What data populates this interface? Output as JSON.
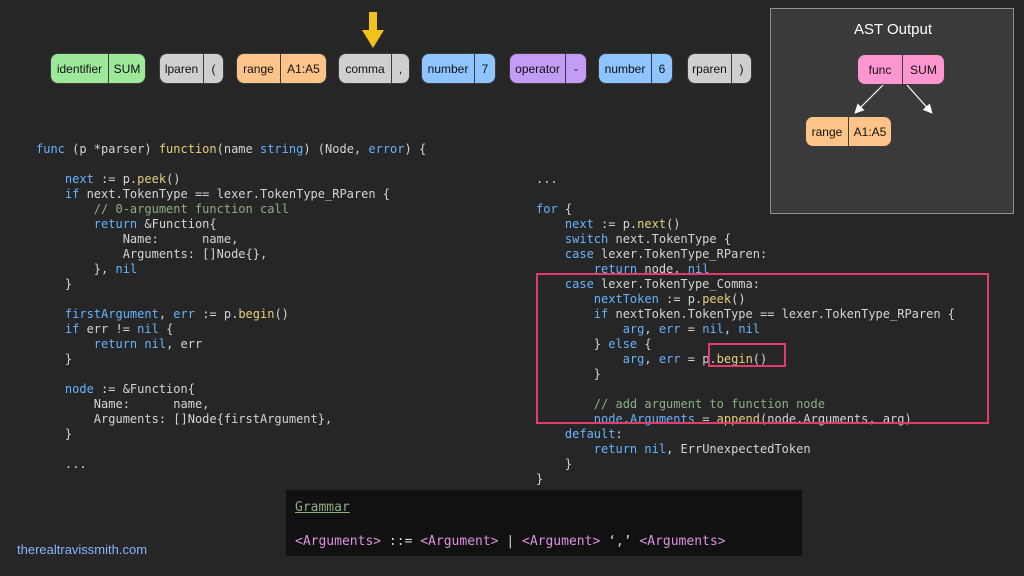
{
  "tokens": [
    {
      "type": "identifier",
      "value": "SUM",
      "color": "#9ee89a"
    },
    {
      "type": "lparen",
      "value": "(",
      "color": "#cfcfcf"
    },
    {
      "type": "range",
      "value": "A1:A5",
      "color": "#fdc48a"
    },
    {
      "type": "comma",
      "value": ",",
      "color": "#cfcfcf"
    },
    {
      "type": "number",
      "value": "7",
      "color": "#8ec4ff"
    },
    {
      "type": "operator",
      "value": "-",
      "color": "#c49cf6"
    },
    {
      "type": "number",
      "value": "6",
      "color": "#8ec4ff"
    },
    {
      "type": "rparen",
      "value": ")",
      "color": "#cfcfcf"
    }
  ],
  "current_token_pointer": {
    "icon": "arrow-down-icon",
    "color": "#f2c21a"
  },
  "code_left": {
    "line1_func": "func",
    "line1_rest": " (p *parser) ",
    "line1_name": "function",
    "line1_args_a": "(name ",
    "line1_string": "string",
    "line1_args_b": ") (Node, ",
    "line1_error": "error",
    "line1_end": ") {",
    "next_var": "next",
    "next_op": " := p.",
    "peek_fn": "peek",
    "next_end": "()",
    "if_kw": "if",
    "if_cond": " next.TokenType == lexer.TokenType_RParen {",
    "comment": "// 0-argument function call",
    "return_kw": "return",
    "return_rest": " &Function{",
    "name_field": "Name:      name,",
    "args_field": "Arguments: []Node{},",
    "close_nil_a": "}, ",
    "nil1": "nil",
    "close1": "}",
    "first_var": "firstArgument",
    "first_mid": ", ",
    "err_var": "err",
    "first_op": " := p.",
    "begin_fn": "begin",
    "first_end": "()",
    "if2_kw": "if",
    "if2_cond": " err != ",
    "nil2": "nil",
    "if2_end": " {",
    "return2_kw": "return",
    "nil3": "nil",
    "return2_end": ", err",
    "close2": "}",
    "node_var": "node",
    "node_rest": " := &Function{",
    "name_field2": "Name:      name,",
    "args_field2": "Arguments: []Node{firstArgument},",
    "close3": "}",
    "ellipsis": "..."
  },
  "code_right": {
    "ellipsis": "...",
    "for_kw": "for",
    "for_end": " {",
    "next_var": "next",
    "next_op": " := p.",
    "next_fn": "next",
    "next_end": "()",
    "switch_kw": "switch",
    "switch_rest": " next.TokenType {",
    "case1_kw": "case",
    "case1_rest": " lexer.TokenType_RParen:",
    "return1_kw": "return",
    "return1_rest": " node, ",
    "nil1": "nil",
    "case2_kw": "case",
    "case2_rest": " lexer.TokenType_Comma:",
    "nt_var": "nextToken",
    "nt_op": " := p.",
    "nt_fn": "peek",
    "nt_end": "()",
    "if_kw": "if",
    "if_cond": " nextToken.TokenType == lexer.TokenType_RParen {",
    "arg_var": "arg",
    "arg_mid": ", ",
    "err_var": "err",
    "arg_eq": " = ",
    "nil2": "nil",
    "arg_comma": ", ",
    "nil3": "nil",
    "else_a": "} ",
    "else_kw": "else",
    "else_b": " {",
    "arg2_var": "arg",
    "arg2_mid": ", ",
    "err2_var": "err",
    "arg2_eq": " = ",
    "begin_call_a": "p.",
    "begin_fn": "begin",
    "begin_call_b": "()",
    "close_inner": "}",
    "comment": "// add argument to function node",
    "append_lhs_a": "node",
    "append_lhs_b": ".",
    "append_lhs_c": "Arguments",
    "append_eq": " = ",
    "append_fn": "append",
    "append_args": "(node.Arguments, arg)",
    "default_kw": "default",
    "default_colon": ":",
    "return2_kw": "return",
    "nil4": "nil",
    "return2_rest": ", ErrUnexpectedToken",
    "close_switch": "}",
    "close_for": "}"
  },
  "ast": {
    "title": "AST Output",
    "root": {
      "type": "func",
      "value": "SUM",
      "color": "#ff96d2"
    },
    "child": {
      "type": "range",
      "value": "A1:A5",
      "color": "#fdc48a"
    }
  },
  "grammar": {
    "title": "Grammar",
    "lhs": "<Arguments>",
    "op": " ::= ",
    "alt1": "<Argument>",
    "bar": " | ",
    "alt2": "<Argument>",
    "comma": " ‘,’ ",
    "alt3": "<Arguments>"
  },
  "watermark": "therealtravissmith.com",
  "colors": {
    "background": "#262626",
    "highlight": "#e23c6a",
    "keyword": "#66b4ff",
    "function": "#e6d07a",
    "comment": "#8fae84"
  }
}
